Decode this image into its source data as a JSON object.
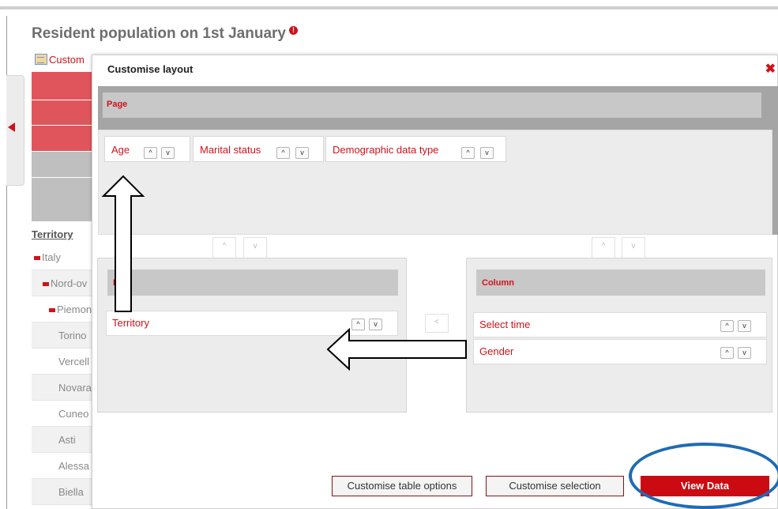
{
  "page": {
    "title": "Resident population on 1st January",
    "info_icon": "info-icon",
    "customise_link": "Custom",
    "territory_header": "Territory",
    "territory_rows": [
      {
        "label": "Italy",
        "expanded": true
      },
      {
        "label": "Nord-ov",
        "expanded": true
      },
      {
        "label": "Piemon",
        "expanded": true
      },
      {
        "label": "Torino"
      },
      {
        "label": "Vercell"
      },
      {
        "label": "Novara"
      },
      {
        "label": "Cuneo"
      },
      {
        "label": "Asti"
      },
      {
        "label": "Alessa"
      },
      {
        "label": "Biella"
      }
    ]
  },
  "modal": {
    "title": "Customise layout",
    "close_icon": "close-icon",
    "page_label": "Page",
    "page_items": [
      {
        "label": "Age"
      },
      {
        "label": "Marital status"
      },
      {
        "label": "Demographic data type"
      }
    ],
    "rows_label": "R",
    "row_items": [
      {
        "label": "Territory"
      }
    ],
    "column_label": "Column",
    "column_items": [
      {
        "label": "Select time"
      },
      {
        "label": "Gender"
      }
    ],
    "up_icon": "^",
    "down_icon": "v",
    "left_icon": "<",
    "buttons": {
      "table_options": "Customise table options",
      "selection": "Customise selection",
      "view_data": "View Data"
    }
  },
  "colors": {
    "accent_red": "#d0121b",
    "view_data_bg": "#cc0a12",
    "highlight_ring": "#1f6bb5"
  }
}
